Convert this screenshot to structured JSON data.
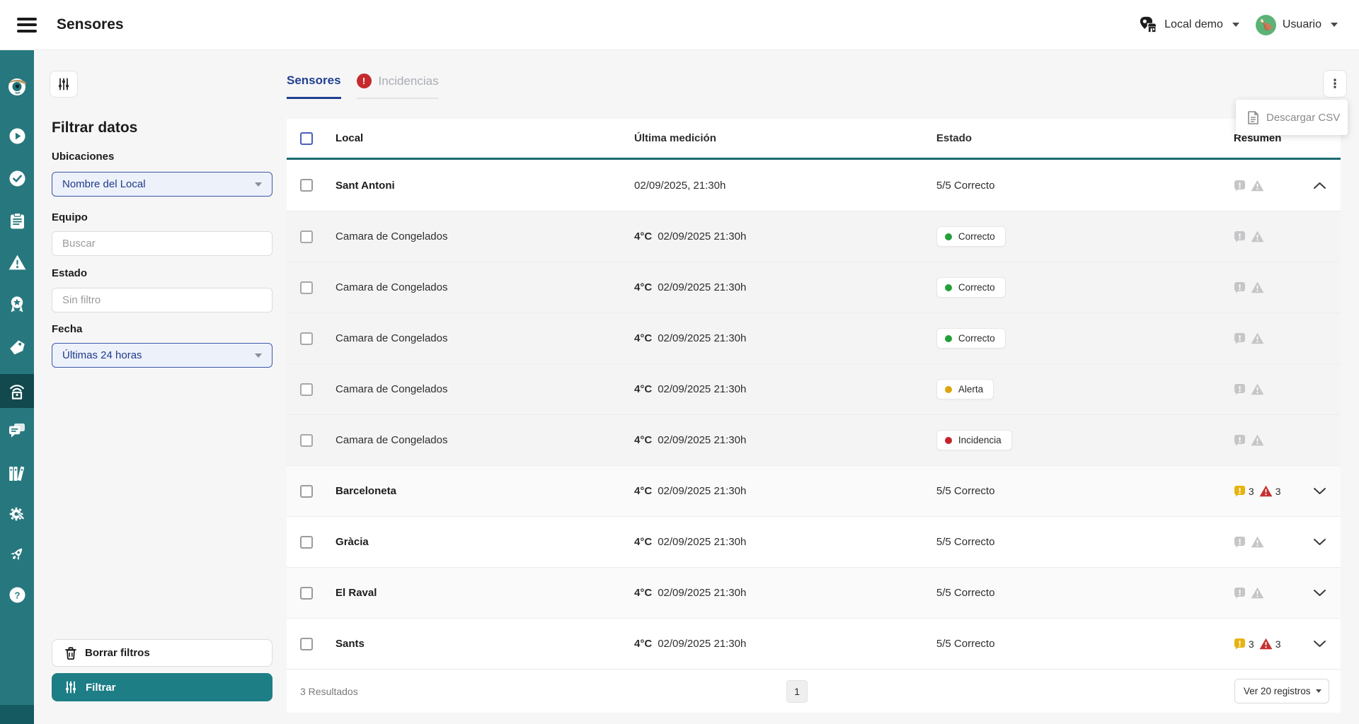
{
  "topbar": {
    "title": "Sensores",
    "location_label": "Local demo",
    "user_label": "Usuario",
    "avatar_emoji": "🍗"
  },
  "rail": {
    "icons": [
      "mascot-logo",
      "play-circle",
      "check-circle",
      "clipboard",
      "warning-triangle",
      "award-badge",
      "tag",
      "sensor-home-active",
      "chat-bubbles",
      "library-books",
      "settings-gear",
      "rocket",
      "help-circle"
    ]
  },
  "filters": {
    "heading": "Filtrar datos",
    "ubicaciones_label": "Ubicaciones",
    "ubicaciones_value": "Nombre del Local",
    "equipo_label": "Equipo",
    "equipo_placeholder": "Buscar",
    "estado_label": "Estado",
    "estado_placeholder": "Sin filtro",
    "fecha_label": "Fecha",
    "fecha_value": "Últimas 24 horas",
    "clear_label": "Borrar filtros",
    "apply_label": "Filtrar"
  },
  "tabs": {
    "sensores": "Sensores",
    "incidencias": "Incidencias",
    "badge": "!"
  },
  "menu": {
    "download_csv": "Descargar CSV"
  },
  "table": {
    "columns": [
      "Local",
      "Última medición",
      "Estado",
      "Resumen"
    ],
    "rows": [
      {
        "type": "location",
        "name": "Sant Antoni",
        "temp": "",
        "datetime": "02/09/2025, 21:30h",
        "estado": "5/5 Correcto",
        "warn_count": "",
        "incident_count": "",
        "chevron": "up",
        "alt": false
      },
      {
        "type": "sensor",
        "name": "Camara de Congelados",
        "temp": "4°C",
        "datetime": "02/09/2025 21:30h",
        "chip": "Correcto"
      },
      {
        "type": "sensor",
        "name": "Camara de Congelados",
        "temp": "4°C",
        "datetime": "02/09/2025 21:30h",
        "chip": "Correcto"
      },
      {
        "type": "sensor",
        "name": "Camara de Congelados",
        "temp": "4°C",
        "datetime": "02/09/2025 21:30h",
        "chip": "Correcto"
      },
      {
        "type": "sensor",
        "name": "Camara de Congelados",
        "temp": "4°C",
        "datetime": "02/09/2025 21:30h",
        "chip": "Alerta"
      },
      {
        "type": "sensor",
        "name": "Camara de Congelados",
        "temp": "4°C",
        "datetime": "02/09/2025 21:30h",
        "chip": "Incidencia"
      },
      {
        "type": "location",
        "name": "Barceloneta",
        "temp": "4°C",
        "datetime": "02/09/2025 21:30h",
        "estado": "5/5 Correcto",
        "warn_count": "3",
        "incident_count": "3",
        "chevron": "down",
        "alt": true
      },
      {
        "type": "location",
        "name": "Gràcia",
        "temp": "4°C",
        "datetime": "02/09/2025 21:30h",
        "estado": "5/5 Correcto",
        "warn_count": "",
        "incident_count": "",
        "chevron": "down",
        "alt": false
      },
      {
        "type": "location",
        "name": "El Raval",
        "temp": "4°C",
        "datetime": "02/09/2025 21:30h",
        "estado": "5/5 Correcto",
        "warn_count": "",
        "incident_count": "",
        "chevron": "down",
        "alt": true
      },
      {
        "type": "location",
        "name": "Sants",
        "temp": "4°C",
        "datetime": "02/09/2025 21:30h",
        "estado": "5/5 Correcto",
        "warn_count": "3",
        "incident_count": "3",
        "chevron": "down",
        "alt": false
      }
    ]
  },
  "footer": {
    "results": "3 Resultados",
    "page": "1",
    "page_size": "Ver 20 registros"
  },
  "colors": {
    "rail": "#27787e",
    "rail_active": "#11494f",
    "accent_teal": "#1d7e86",
    "tab_blue": "#20418f",
    "chip_correcto": "#22a038",
    "chip_alerta": "#dfa50f",
    "chip_incidencia": "#c5232b",
    "icon_disabled": "#c6c6c8",
    "icon_warn": "#e7b30f",
    "icon_incident": "#c53030",
    "header_line": "#1a6a70"
  }
}
